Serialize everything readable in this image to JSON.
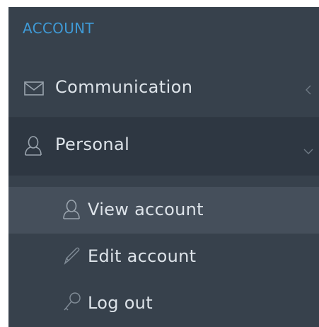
{
  "sidebar": {
    "section_title": "ACCOUNT",
    "items": [
      {
        "label": "Communication",
        "icon": "envelope-icon",
        "chevron": "chevron-left-icon"
      },
      {
        "label": "Personal",
        "icon": "user-icon",
        "chevron": "chevron-down-icon",
        "expanded": true,
        "children": [
          {
            "label": "View account",
            "icon": "user-icon",
            "active": true
          },
          {
            "label": "Edit account",
            "icon": "pencil-icon"
          },
          {
            "label": "Log out",
            "icon": "key-icon"
          }
        ]
      }
    ]
  },
  "colors": {
    "sidebar_bg": "#37414c",
    "active_parent_bg": "#2e3742",
    "active_child_bg": "#454f5b",
    "section_title": "#3f9ad6",
    "text": "#dde3e9",
    "icon": "#9aa4ae"
  }
}
